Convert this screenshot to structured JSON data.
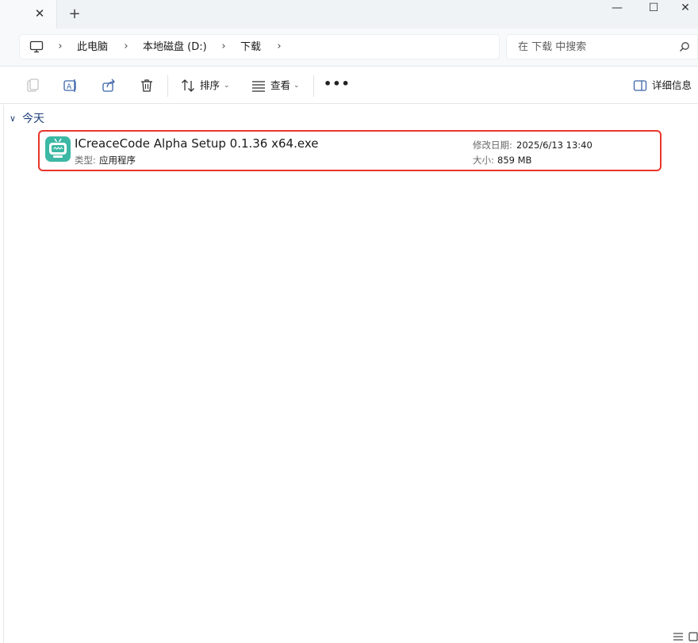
{
  "window": {
    "tab_close_glyph": "✕",
    "new_tab_glyph": "+",
    "minimize_glyph": "—",
    "maximize_glyph": "☐",
    "close_glyph": "✕"
  },
  "address": {
    "crumbs": [
      "此电脑",
      "本地磁盘 (D:)",
      "下载"
    ],
    "separator": "›",
    "search_placeholder": "在 下载 中搜索"
  },
  "toolbar": {
    "sort_label": "排序",
    "view_label": "查看",
    "more_label": "•••",
    "details_label": "详细信息",
    "caret": "⌄"
  },
  "group": {
    "title": "今天",
    "chevron": "∨"
  },
  "file": {
    "name": "ICreaceCode Alpha Setup 0.1.36 x64.exe",
    "type_key": "类型:",
    "type_value": "应用程序",
    "date_key": "修改日期:",
    "date_value": "2025/6/13 13:40",
    "size_key": "大小:",
    "size_value": "859 MB"
  },
  "colors": {
    "accent": "#1d3f7a",
    "highlight_border": "#e8362b",
    "icon_bg": "#3cb8a4"
  }
}
